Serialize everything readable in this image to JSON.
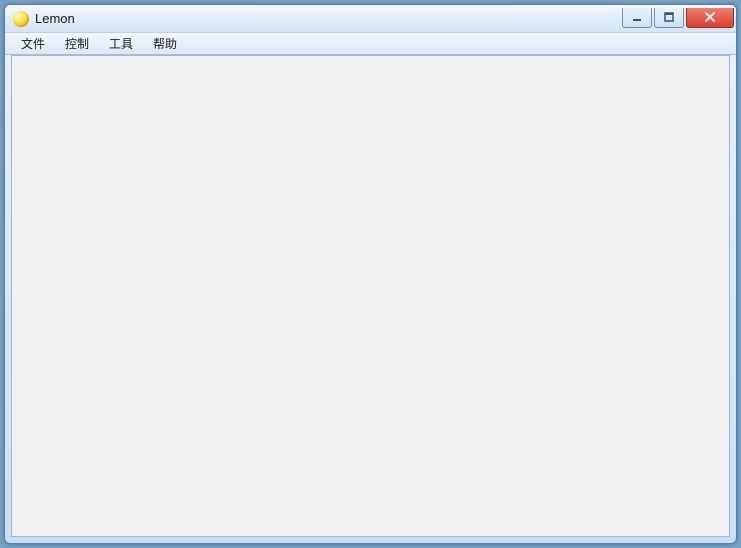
{
  "titlebar": {
    "app_icon_name": "lemon-icon",
    "title": "Lemon",
    "buttons": {
      "minimize_name": "minimize-icon",
      "maximize_name": "maximize-icon",
      "close_name": "close-icon"
    }
  },
  "menubar": {
    "items": [
      {
        "label": "文件",
        "name": "menu-file"
      },
      {
        "label": "控制",
        "name": "menu-control"
      },
      {
        "label": "工具",
        "name": "menu-tools"
      },
      {
        "label": "帮助",
        "name": "menu-help"
      }
    ]
  }
}
